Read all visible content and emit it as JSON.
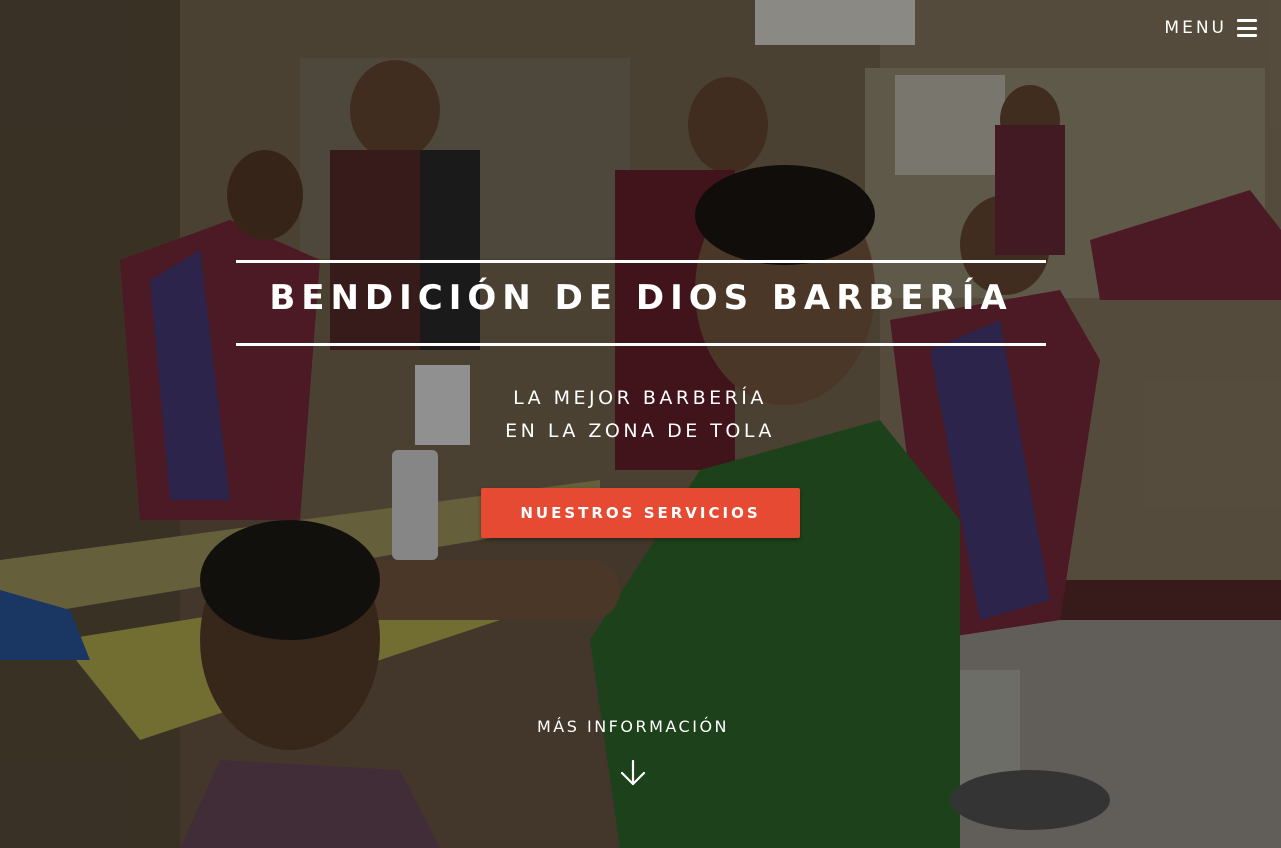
{
  "nav": {
    "menu_label": "MENU"
  },
  "hero": {
    "title": "BENDICIÓN DE DIOS BARBERÍA",
    "subtitle_line1": "LA MEJOR BARBERÍA",
    "subtitle_line2": "EN LA ZONA DE TOLA",
    "cta_label": "NUESTROS SERVICIOS",
    "more_label": "MÁS INFORMACIÓN",
    "more_icon": "arrow-down-icon"
  },
  "colors": {
    "accent": "#e64a33",
    "text": "#ffffff"
  }
}
